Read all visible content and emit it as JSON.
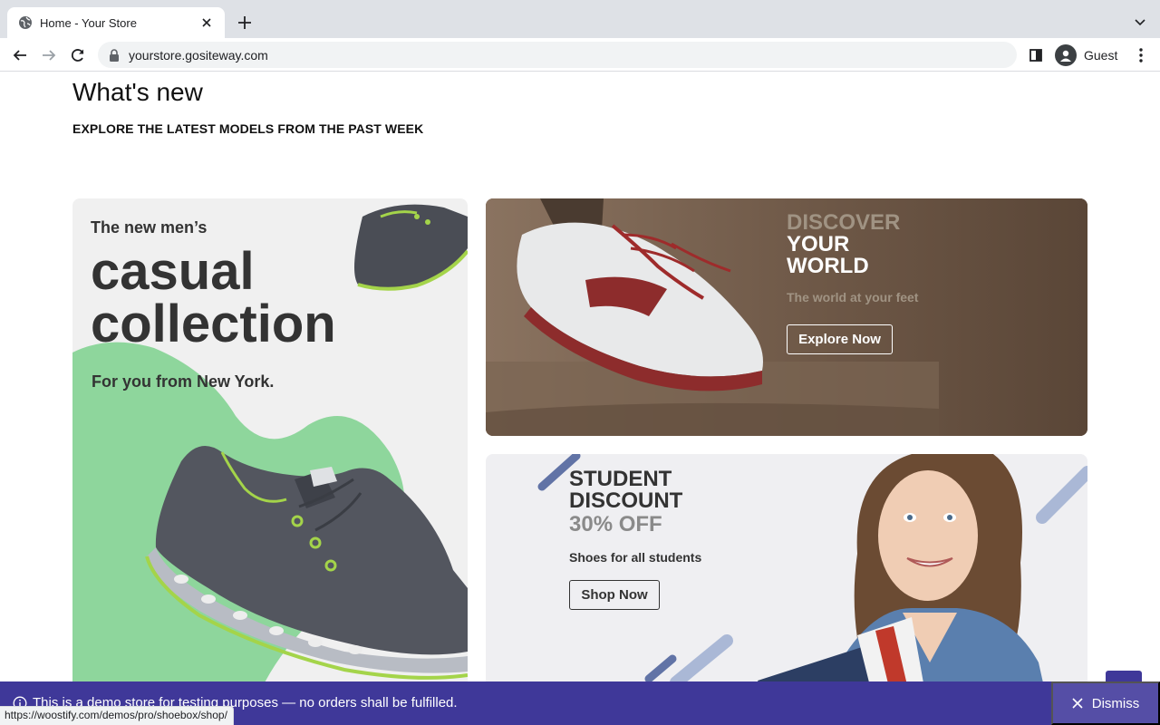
{
  "browser": {
    "tab": {
      "title": "Home - Your Store",
      "favicon": "globe-icon"
    },
    "address": {
      "url": "yourstore.gositeway.com",
      "secure_icon": "lock-icon"
    },
    "profile": {
      "label": "Guest"
    },
    "status_url": "https://woostify.com/demos/pro/shoebox/shop/"
  },
  "section": {
    "title": "What's new",
    "subtitle": "EXPLORE THE LATEST MODELS FROM THE PAST WEEK"
  },
  "banners": {
    "casual": {
      "eyebrow": "The new men’s",
      "headline_line1": "casual",
      "headline_line2": "collection",
      "tagline": "For you from New York."
    },
    "discover": {
      "kicker": "DISCOVER",
      "title_line1": "YOUR",
      "title_line2": "WORLD",
      "caption": "The world at your feet",
      "button": "Explore Now"
    },
    "student": {
      "title_line1": "STUDENT",
      "title_line2": "DISCOUNT",
      "offer": "30% OFF",
      "caption": "Shoes for all students",
      "button": "Shop Now"
    }
  },
  "notice": {
    "text": "This is a demo store for testing purposes — no orders shall be fulfilled.",
    "dismiss": "Dismiss"
  },
  "colors": {
    "accent": "#3f3899",
    "dismiss_bg": "#554ea6",
    "discover_bg": "#5a4637",
    "casual_blob": "#8ed69c"
  }
}
